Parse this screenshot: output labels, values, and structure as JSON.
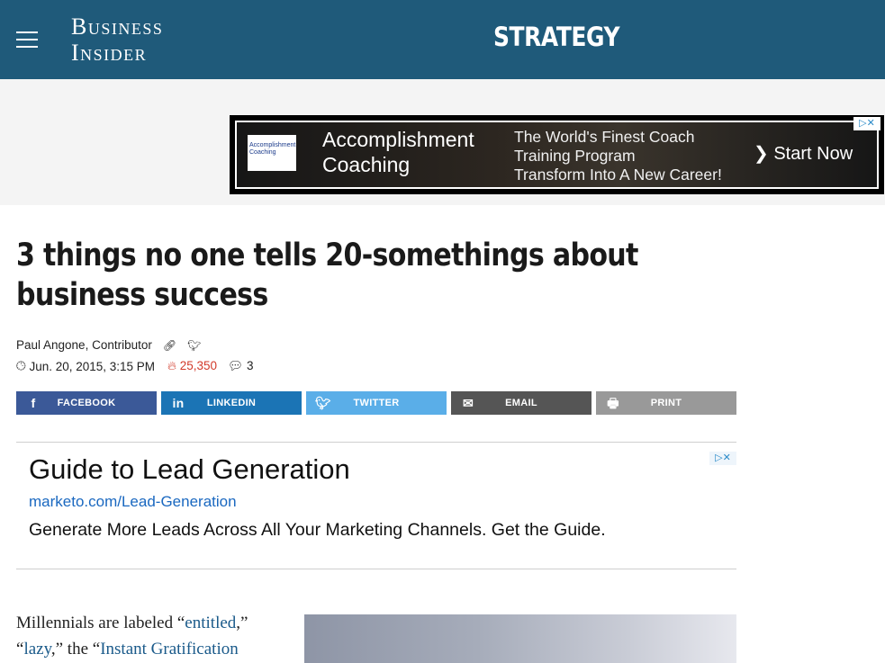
{
  "header": {
    "logo_line1": "Business",
    "logo_line2": "Insider",
    "section": "STRATEGY"
  },
  "top_ad": {
    "logo_text": "Accomplishment Coaching",
    "brand_line1": "Accomplishment",
    "brand_line2": "Coaching",
    "line1": "The World's Finest Coach",
    "line2": "Training Program",
    "line3": "Transform Into A New Career!",
    "cta": "Start Now",
    "adchoices": "▷✕"
  },
  "article": {
    "headline": "3 things no one tells 20-somethings about business success",
    "author": "Paul Angone, Contributor",
    "date": "Jun. 20, 2015, 3:15 PM",
    "views": "25,350",
    "comments": "3"
  },
  "share": {
    "facebook": "FACEBOOK",
    "linkedin": "LINKEDIN",
    "twitter": "TWITTER",
    "email": "EMAIL",
    "print": "PRINT"
  },
  "text_ad": {
    "title": "Guide to Lead Generation",
    "url": "marketo.com/Lead-Generation",
    "description": "Generate More Leads Across All Your Marketing Channels. Get the Guide.",
    "adchoices": "▷✕"
  },
  "body": {
    "p1_start": "Millennials are labeled “",
    "link_entitled": "entitled",
    "p1_mid": ",”",
    "p1_q": "“",
    "link_lazy": "lazy",
    "p1_mid2": ",” the “",
    "link_instant": "Instant Gratification"
  },
  "colors": {
    "header_bg": "#1f5a7a",
    "facebook": "#3b5998",
    "linkedin": "#1b74b5",
    "twitter": "#5aaee8",
    "email": "#555555",
    "print": "#999999",
    "views_red": "#d23a2a",
    "link_blue": "#1a5a8a"
  }
}
